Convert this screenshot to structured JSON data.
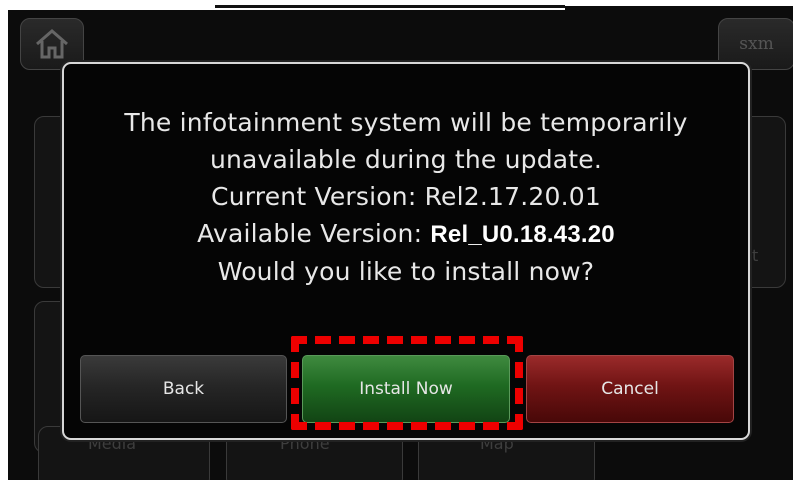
{
  "top_bar": {
    "home_icon": "home-icon",
    "sxm_label": "sxm"
  },
  "background": {
    "tiles": [
      {
        "label": "Media"
      },
      {
        "label": "Phone"
      },
      {
        "label": "Map"
      }
    ],
    "edge_letter": "t"
  },
  "dialog": {
    "line1": "The infotainment system will be temporarily",
    "line2": "unavailable during the update.",
    "current_version_label": "Current Version: Rel2.17.20.01",
    "available_version_label": "Available Version: ",
    "available_version_value": "Rel_U0.18.43.20",
    "question": "Would you like to install now?",
    "buttons": {
      "back": "Back",
      "install": "Install Now",
      "cancel": "Cancel"
    }
  },
  "colors": {
    "install_button": "#1f6a22",
    "cancel_button": "#701414",
    "highlight": "#ee0000"
  }
}
